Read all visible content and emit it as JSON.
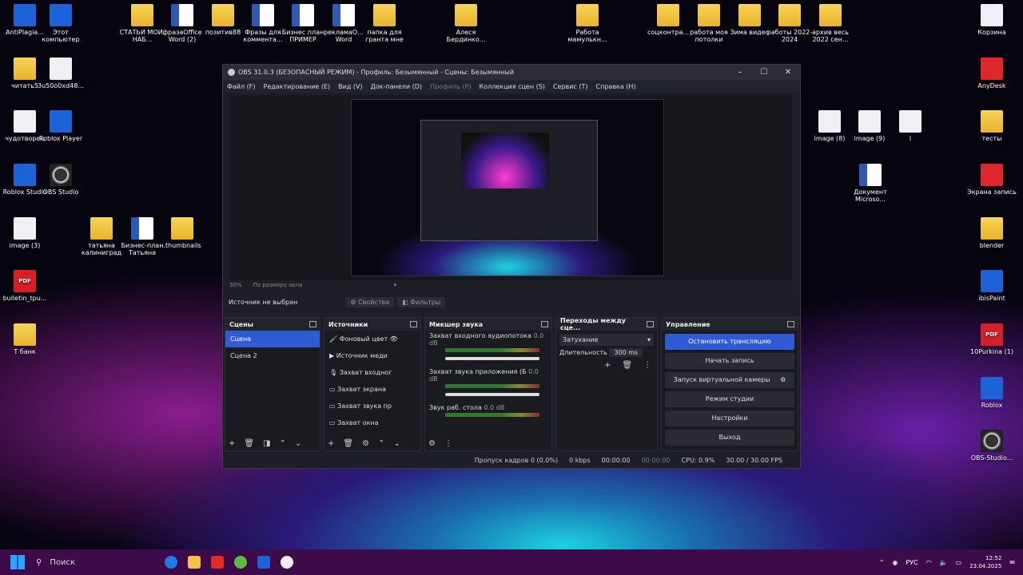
{
  "desktop": {
    "icons": [
      {
        "label": "AntiPlagia...",
        "type": "blue",
        "x": 0
      },
      {
        "label": "Этот компьютер",
        "type": "blue"
      },
      {
        "label": "СТАТЬИ МОИ, НАБ...",
        "type": "folder"
      },
      {
        "label": "фразаOffice Word (2)",
        "type": "word"
      },
      {
        "label": "позитив88",
        "type": "folder"
      },
      {
        "label": "Фразы для коммента...",
        "type": "word"
      },
      {
        "label": "Бизнес план ПРИМЕР",
        "type": "word"
      },
      {
        "label": "рекламаО... Word",
        "type": "word"
      },
      {
        "label": "папка для гранта мне",
        "type": "folder"
      },
      {
        "label": "Алеся Бердинко...",
        "type": "folder"
      },
      {
        "label": "Работа мамулькн...",
        "type": "folder"
      },
      {
        "label": "соцконтра...",
        "type": "folder"
      },
      {
        "label": "работа моя потолки",
        "type": "folder"
      },
      {
        "label": "Зима видео",
        "type": "folder"
      },
      {
        "label": "работы 2022-2024",
        "type": "folder"
      },
      {
        "label": "архив весь 2022 сен...",
        "type": "folder"
      },
      {
        "label": "Корзина",
        "type": "white"
      },
      {
        "label": "читать5",
        "type": "folder"
      },
      {
        "label": "3u50o0xd48...",
        "type": "white"
      },
      {
        "label": "AnyDesk",
        "type": "red"
      },
      {
        "label": "чудотворец",
        "type": "white"
      },
      {
        "label": "Roblox Player",
        "type": "blue"
      },
      {
        "label": "image (8)",
        "type": "white"
      },
      {
        "label": "image (9)",
        "type": "white"
      },
      {
        "label": "i",
        "type": "white"
      },
      {
        "label": "тесты",
        "type": "folder"
      },
      {
        "label": "Roblox Studio",
        "type": "blue"
      },
      {
        "label": "OBS Studio",
        "type": "obs"
      },
      {
        "label": "Документ Microso...",
        "type": "word"
      },
      {
        "label": "Экрана запись",
        "type": "red"
      },
      {
        "label": "image (3)",
        "type": "white"
      },
      {
        "label": "татьяна калиниград",
        "type": "folder"
      },
      {
        "label": "Бизнес-план Татьяна",
        "type": "word"
      },
      {
        "label": ".thumbnails",
        "type": "folder"
      },
      {
        "label": "blender",
        "type": "folder"
      },
      {
        "label": "bulletin_tpu...",
        "type": "pdf"
      },
      {
        "label": "ibisPaint",
        "type": "blue"
      },
      {
        "label": "Т банк",
        "type": "folder"
      },
      {
        "label": "10Purkina (1)",
        "type": "pdf"
      },
      {
        "label": "Roblox",
        "type": "blue"
      },
      {
        "label": "OBS-Studio...",
        "type": "obs"
      }
    ]
  },
  "obs": {
    "title": "OBS 31.0.3 (БЕЗОПАСНЫЙ РЕЖИМ) - Профиль: Безымянный - Сцены: Безымянный",
    "menu": [
      "Файл (F)",
      "Редактирование (E)",
      "Вид (V)",
      "Док-панели (D)",
      "Профиль (P)",
      "Коллекция сцен (S)",
      "Сервис (T)",
      "Справка (H)"
    ],
    "zoom": "30%",
    "zoom_mode": "По размеру окна",
    "no_source": "Источник не выбран",
    "props_btn": "Свойства",
    "filters_btn": "Фильтры",
    "scenes": {
      "title": "Сцены",
      "items": [
        "Сцена",
        "Сцена 2"
      ]
    },
    "sources": {
      "title": "Источники",
      "items": [
        "Фоновый цвет",
        "Источник меди",
        "Захват входног",
        "Захват экрана",
        "Захват звука пр",
        "Захват окна"
      ]
    },
    "mixer": {
      "title": "Микшер звука",
      "channels": [
        {
          "name": "Захват входного аудиопотока",
          "db": "0.0 dB"
        },
        {
          "name": "Захват звука приложения (Б",
          "db": "0.0 dB"
        },
        {
          "name": "Звук раб. стола",
          "db": "0.0 dB"
        }
      ]
    },
    "transitions": {
      "title": "Переходы между сце...",
      "type": "Затухание",
      "duration_label": "Длительность",
      "duration": "300 ms"
    },
    "controls": {
      "title": "Управление",
      "stop_stream": "Остановить трансляцию",
      "start_rec": "Начать запись",
      "virtual_cam": "Запуск виртуальной камеры",
      "studio": "Режим студии",
      "settings": "Настройки",
      "exit": "Выход"
    },
    "status": {
      "dropped": "Пропуск кадров 0 (0.0%)",
      "kbps": "0 kbps",
      "stream_time": "00:00:00",
      "rec_time": "00:00:00",
      "cpu": "CPU: 0.9%",
      "fps": "30.00 / 30.00 FPS"
    }
  },
  "taskbar": {
    "search": "Поиск",
    "lang": "РУС",
    "time": "12:52",
    "date": "23.04.2025"
  }
}
